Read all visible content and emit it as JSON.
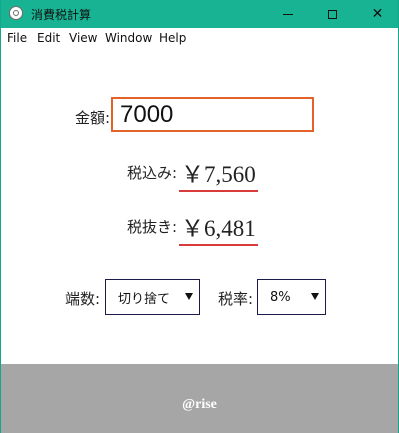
{
  "window": {
    "title": "消費税計算",
    "colors": {
      "titlebar": "#17b393",
      "footer": "#a6a6a6",
      "input_border": "#e2622a",
      "underline": "#d93a3a"
    }
  },
  "window_controls": {
    "minimize_icon": "minimize-icon",
    "maximize_icon": "maximize-icon",
    "close_glyph": "✕"
  },
  "menu": [
    "File",
    "Edit",
    "View",
    "Window",
    "Help"
  ],
  "form": {
    "amount_label": "金額:",
    "amount_value": "7000",
    "tax_included_label": "税込み:",
    "tax_included_value": "￥7,560",
    "tax_excluded_label": "税抜き:",
    "tax_excluded_value": "￥6,481",
    "rounding_label": "端数:",
    "rounding_value": "切り捨て",
    "rate_label": "税率:",
    "rate_value": "8%"
  },
  "footer": {
    "text": "@rise"
  }
}
